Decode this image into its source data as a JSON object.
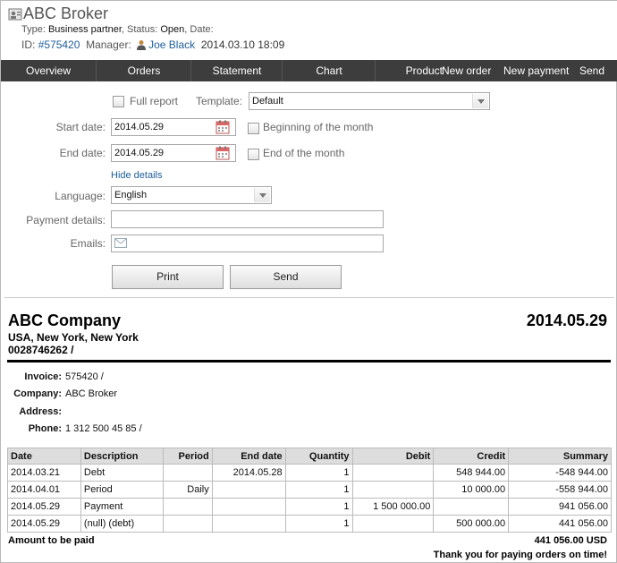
{
  "header": {
    "title": "ABC Broker",
    "type_label": "Type:",
    "type_value": "Business partner",
    "status_label": "Status:",
    "status_value": "Open",
    "date_label": "Date:",
    "id_label": "ID:",
    "id_value": "#575420",
    "manager_label": "Manager:",
    "manager_value": "Joe Black",
    "datetime": "2014.03.10 18:09"
  },
  "nav": {
    "tabs": [
      "Overview",
      "Orders",
      "Statement",
      "Chart",
      "Product"
    ],
    "actions": [
      "New order",
      "New payment",
      "Send"
    ]
  },
  "form": {
    "full_report_label": "Full report",
    "template_label": "Template:",
    "template_value": "Default",
    "start_date_label": "Start date:",
    "start_date_value": "2014.05.29",
    "beginning_label": "Beginning of the month",
    "end_date_label": "End date:",
    "end_date_value": "2014.05.29",
    "end_month_label": "End of the month",
    "hide_details": "Hide details",
    "language_label": "Language:",
    "language_value": "English",
    "payment_details_label": "Payment details:",
    "payment_details_value": "",
    "emails_label": "Emails:",
    "emails_value": "",
    "print_button": "Print",
    "send_button": "Send"
  },
  "invoice": {
    "company": "ABC Company",
    "address": "USA, New York, New York",
    "phone_top": "0028746262 /",
    "date": "2014.05.29",
    "invoice_label": "Invoice:",
    "invoice_value": "575420 /",
    "company_label": "Company:",
    "company_value": "ABC Broker",
    "address_label": "Address:",
    "address_value": "",
    "phone_label": "Phone:",
    "phone_value": "1 312 500 45 85 /",
    "columns": [
      "Date",
      "Description",
      "Period",
      "End date",
      "Quantity",
      "Debit",
      "Credit",
      "Summary"
    ],
    "rows": [
      [
        "2014.03.21",
        "Debt",
        "",
        "2014.05.28",
        "1",
        "",
        "548 944.00",
        "-548 944.00"
      ],
      [
        "2014.04.01",
        "Period",
        "Daily",
        "",
        "1",
        "",
        "10 000.00",
        "-558 944.00"
      ],
      [
        "2014.05.29",
        "Payment",
        "",
        "",
        "1",
        "1 500 000.00",
        "",
        "941 056.00"
      ],
      [
        "2014.05.29",
        "(null) (debt)",
        "",
        "",
        "1",
        "",
        "500 000.00",
        "441 056.00"
      ]
    ],
    "amount_label": "Amount to be paid",
    "amount_value": "441 056.00 USD",
    "thanks": "Thank you for paying orders on time!"
  }
}
